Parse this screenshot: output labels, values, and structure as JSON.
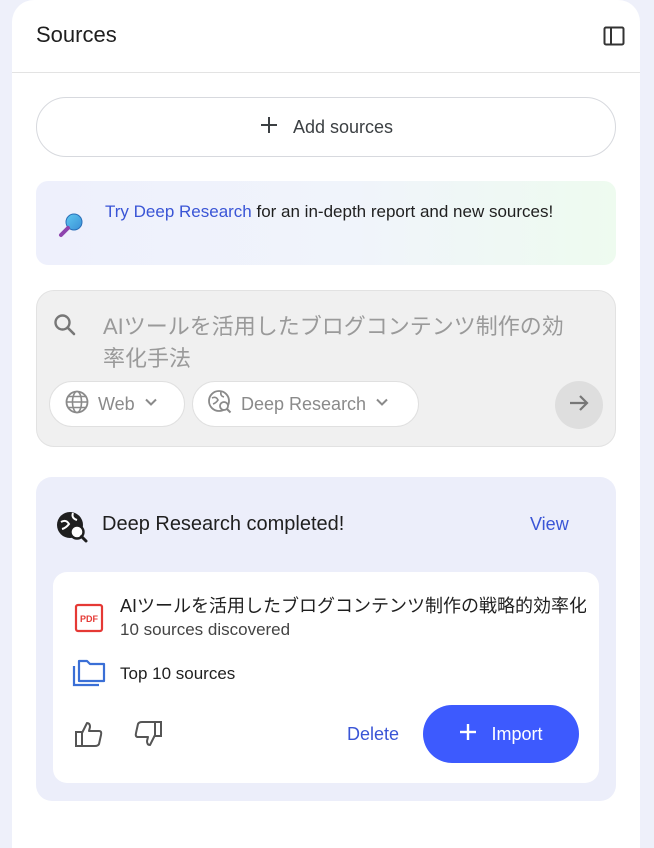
{
  "header": {
    "title": "Sources",
    "collapse_icon": "panel-toggle-icon"
  },
  "add_sources": {
    "label": "Add sources"
  },
  "promo": {
    "link_text": "Try Deep Research",
    "text": " for an in-depth report and new sources!"
  },
  "search": {
    "query": "AIツールを活用したブログコンテンツ制作の効率化手法",
    "web_chip": "Web",
    "research_chip": "Deep Research"
  },
  "result": {
    "title": "Deep Research completed!",
    "view_label": "View",
    "report_title": "AIツールを活用したブログコンテンツ制作の戦略的効率化",
    "sources_discovered": "10 sources discovered",
    "top_sources": "Top 10 sources",
    "delete_label": "Delete",
    "import_label": "Import"
  },
  "colors": {
    "accent": "#3d5afe",
    "link": "#3a55d6",
    "pdf": "#e53935"
  }
}
